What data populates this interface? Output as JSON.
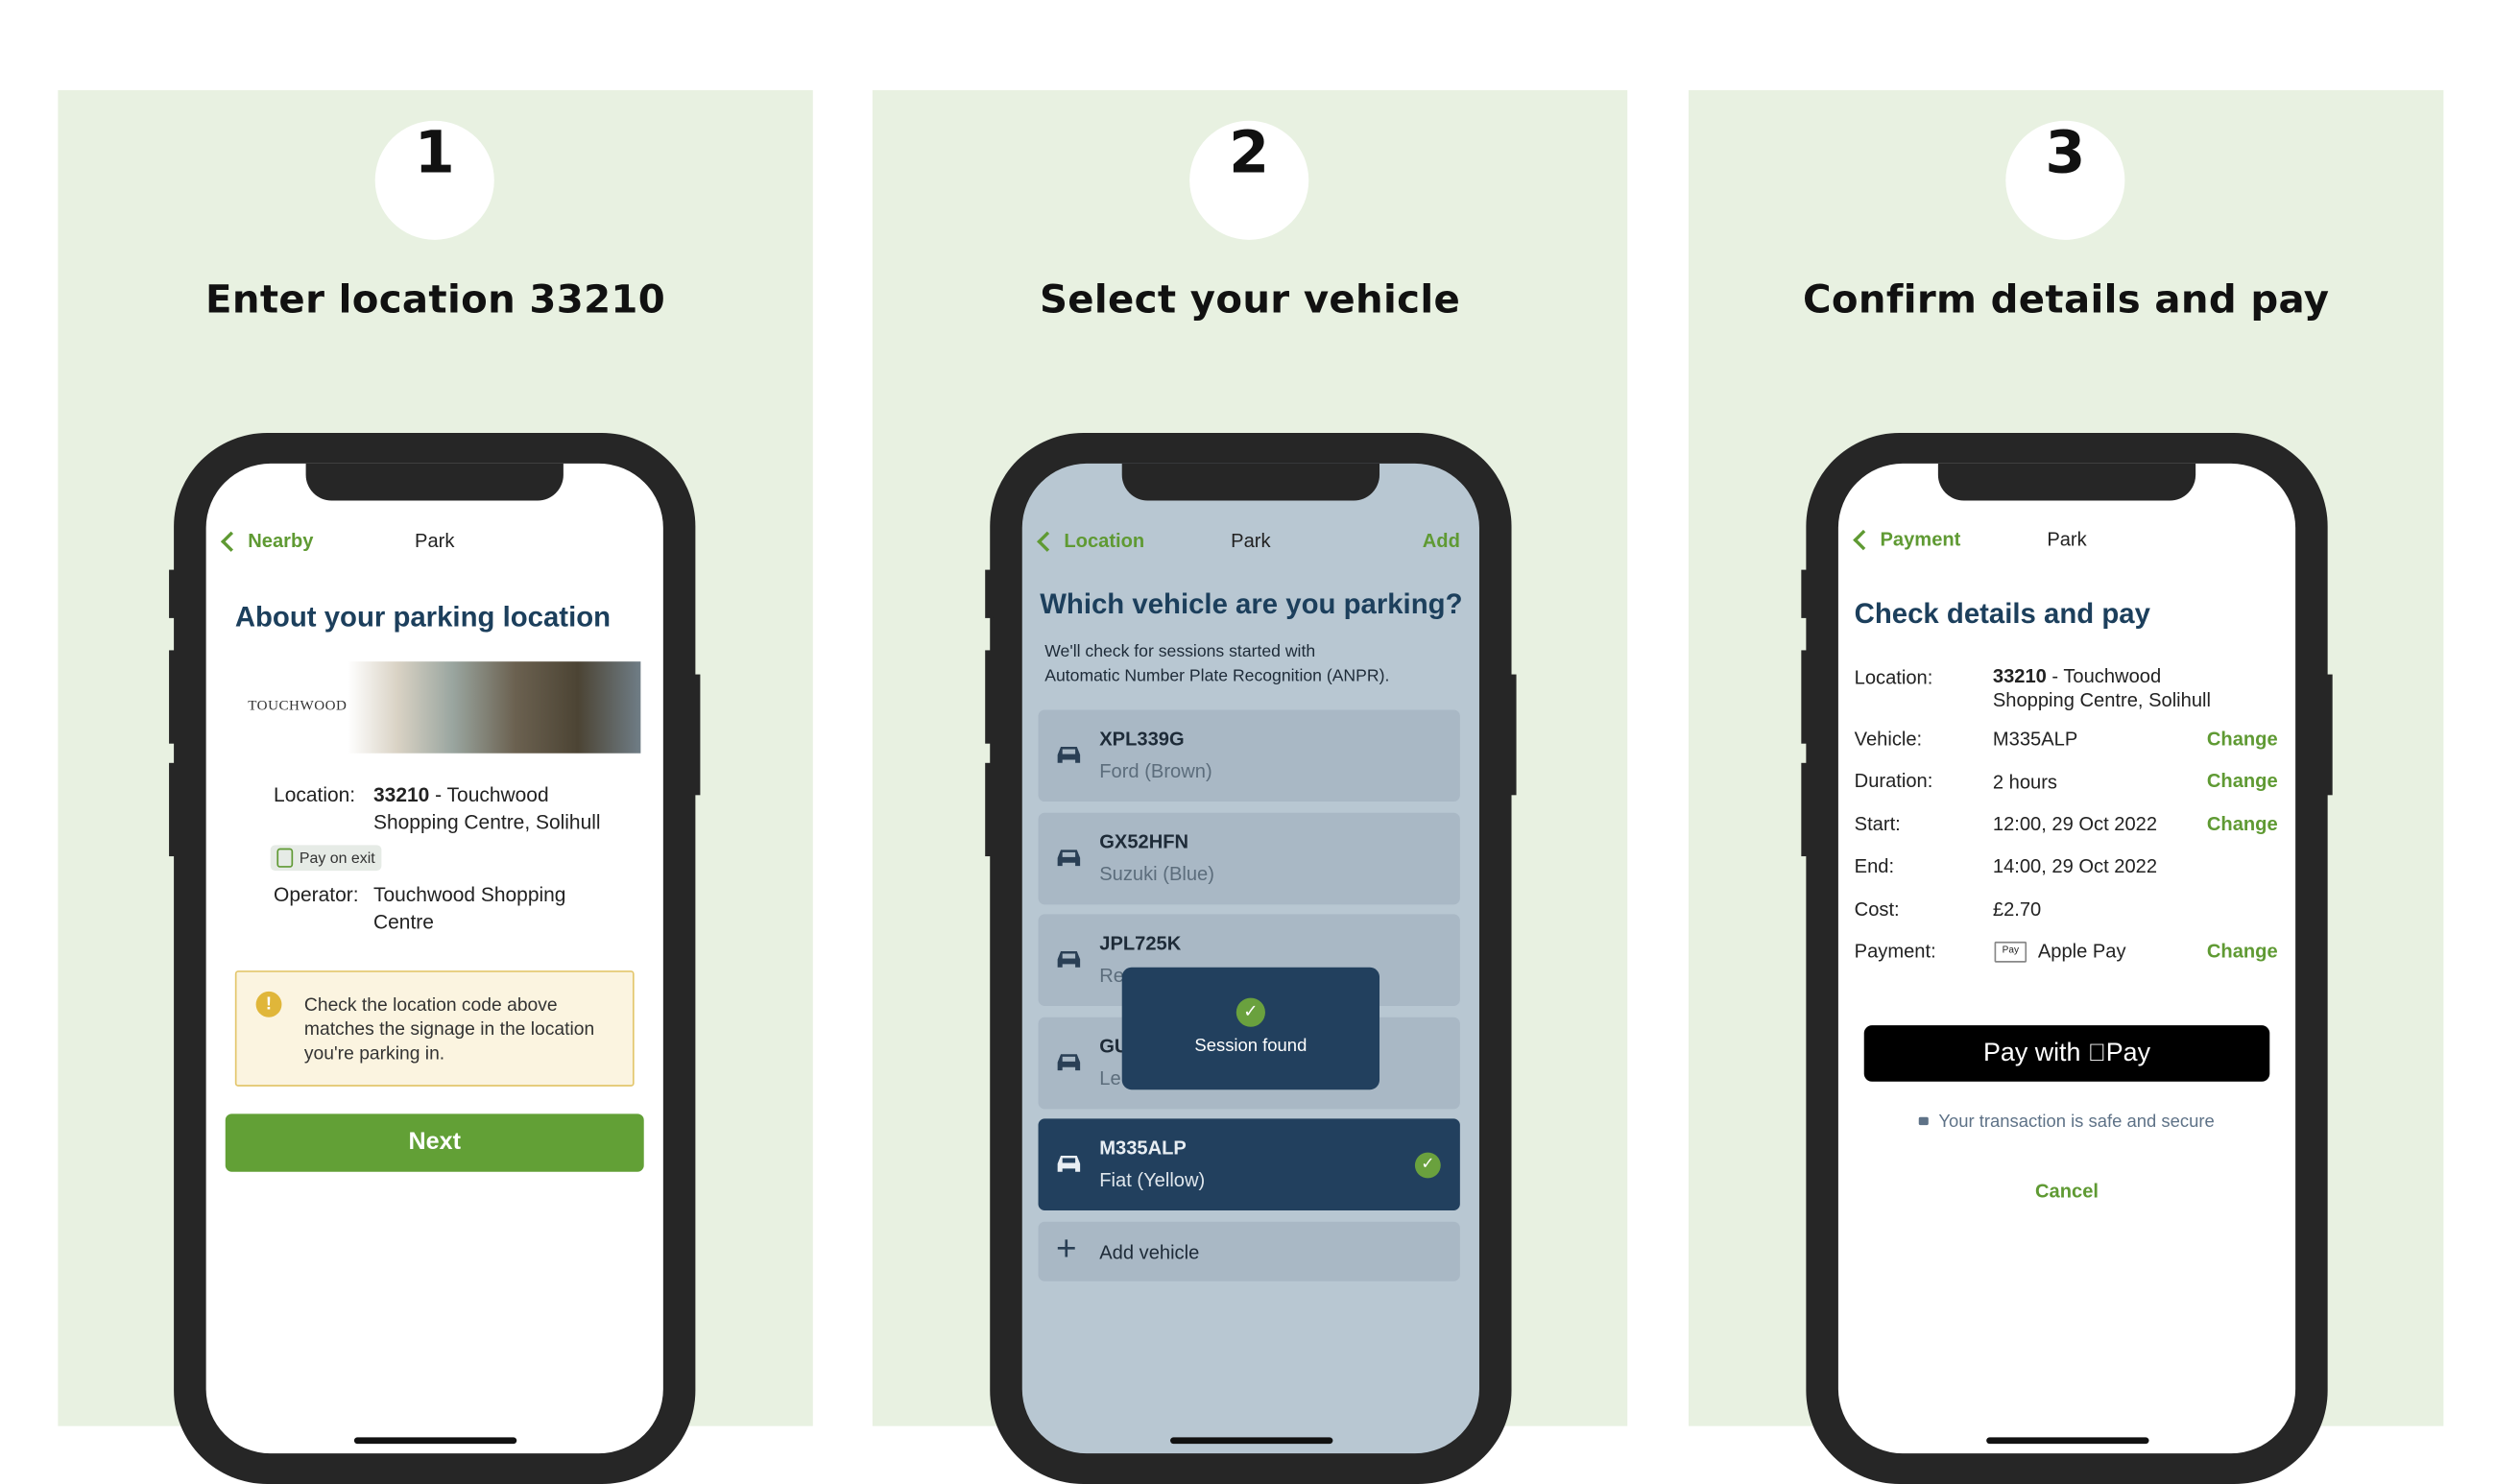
{
  "steps": [
    {
      "number": "1",
      "title": "Enter location 33210"
    },
    {
      "number": "2",
      "title": "Select your vehicle"
    },
    {
      "number": "3",
      "title": "Confirm details and pay"
    }
  ],
  "colors": {
    "panel_bg": "#e8f1e1",
    "accent_green": "#5f9a33",
    "heading_navy": "#1c3f5c",
    "selected_navy": "#22405e"
  },
  "screen1": {
    "nav": {
      "back": "Nearby",
      "title": "Park"
    },
    "heading": "About your parking location",
    "banner_logo": "TOUCHWOOD",
    "location_label": "Location:",
    "location_code": "33210",
    "location_name_line1": " - Touchwood",
    "location_name_line2": "Shopping Centre, Solihull",
    "badge": "Pay on exit",
    "operator_label": "Operator:",
    "operator_value": "Touchwood Shopping Centre",
    "warning": "Check the location code above matches the signage in the location you're parking in.",
    "next_button": "Next"
  },
  "screen2": {
    "nav": {
      "back": "Location",
      "title": "Park",
      "right": "Add"
    },
    "heading": "Which vehicle are you parking?",
    "subtext_line1": "We'll check for sessions started with",
    "subtext_line2": "Automatic Number Plate Recognition (ANPR).",
    "vehicles": [
      {
        "plate": "XPL339G",
        "desc": "Ford (Brown)"
      },
      {
        "plate": "GX52HFN",
        "desc": "Suzuki (Blue)"
      },
      {
        "plate": "JPL725K",
        "desc": "Re"
      },
      {
        "plate": "GU",
        "desc": "Le"
      },
      {
        "plate": "M335ALP",
        "desc": "Fiat (Yellow)",
        "selected": true
      }
    ],
    "add_vehicle": "Add vehicle",
    "toast": "Session found"
  },
  "screen3": {
    "nav": {
      "back": "Payment",
      "title": "Park"
    },
    "heading": "Check details and pay",
    "rows": {
      "location": {
        "label": "Location:",
        "code": "33210",
        "line1": " - Touchwood",
        "line2": "Shopping Centre, Solihull"
      },
      "vehicle": {
        "label": "Vehicle:",
        "value": "M335ALP",
        "action": "Change"
      },
      "duration": {
        "label": "Duration:",
        "value": "2 hours",
        "action": "Change"
      },
      "start": {
        "label": "Start:",
        "value": "12:00, 29 Oct 2022",
        "action": "Change"
      },
      "end": {
        "label": "End:",
        "value": "14:00, 29 Oct 2022"
      },
      "cost": {
        "label": "Cost:",
        "value": "£2.70"
      },
      "payment": {
        "label": "Payment:",
        "value": "Apple Pay",
        "card_mark": "Pay",
        "action": "Change"
      }
    },
    "pay_button_prefix": "Pay with",
    "pay_button_brand": "Pay",
    "secure_note": "Your transaction is safe and secure",
    "cancel": "Cancel"
  }
}
